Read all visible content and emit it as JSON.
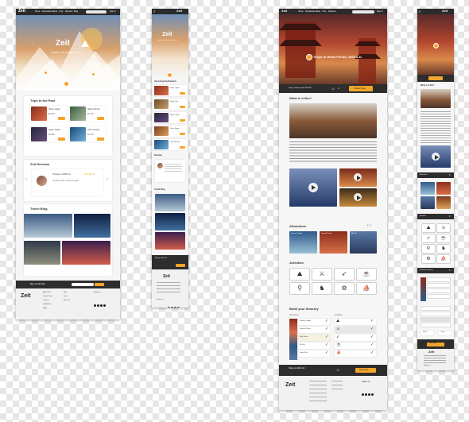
{
  "brand": {
    "name": "Zeit",
    "tagline": "Explore The Portals Of Time"
  },
  "nav": {
    "links": [
      "Home",
      "Destinations",
      "Eras",
      "Trips",
      "Reviews",
      "Blog",
      "Contact"
    ],
    "login": "Sign In"
  },
  "screen1": {
    "past_trips": {
      "title": "Trips to the Past",
      "cards": [
        {
          "name": "Tokyo, Japan",
          "price": "$2,450"
        },
        {
          "name": "Machu Picchu",
          "price": "$3,100"
        },
        {
          "name": "Kyoto, Japan",
          "price": "$1,980"
        },
        {
          "name": "Oslo, Norway",
          "price": "$2,750"
        }
      ],
      "book_label": "Book"
    },
    "reviews": {
      "title": "Zeit Reviews",
      "reviewer": "Traveler in 1950 B.C.",
      "stars": "★★★★★",
      "quote": "\"Amazing trip, would go again\""
    },
    "blog": {
      "title": "Travel Blog",
      "posts": [
        "Northern Lights",
        "Ancient Cities",
        "Mountain Trails",
        "Lost Coasts"
      ]
    },
    "newsletter": {
      "label": "Sign up with Zeit",
      "placeholder": "Email",
      "button": "Sign Up"
    },
    "footer": {
      "col1": [
        "About Zeit",
        "Travel Tours",
        "Careers",
        "Guidelines",
        "FAQs"
      ],
      "col2": [
        "Help",
        "Trips",
        "Account"
      ],
      "follow": "Follow us"
    }
  },
  "screen2": {
    "upcoming": {
      "title": "Upcoming Destinations",
      "items": [
        "Tokyo, Japan",
        "Rome, Italy",
        "Kyoto, Japan",
        "Cairo, Egypt",
        "Oslo, Norway"
      ]
    },
    "reviews_title": "Reviews",
    "blog_title": "Travel Blog",
    "newsletter": {
      "label": "Sign up with Zeit",
      "button": "Sign Up"
    },
    "follow": "Follow us"
  },
  "screen3": {
    "hero_title": "Tokyo in Heian Period, 1000 A.D.",
    "bar": {
      "destination": "Tokyo in Heian Period, 1000 A.D.",
      "travelers": "2",
      "book": "Book Now"
    },
    "what_title": "What is it like?",
    "body_text": "Lorem ipsum dolor sit amet, consectetur adipiscing elit, sed diam nonummy nibh euismod tincidunt ut laoreet dolore magna aliquam erat volutpat.",
    "attractions": {
      "title": "Attractions",
      "items": [
        "Senso-ji Temple",
        "Imperial Palace",
        "Mt. Fuji"
      ]
    },
    "activities": {
      "title": "Activities",
      "icons": [
        "hiking-icon",
        "sword-icon",
        "archery-icon",
        "tea-icon",
        "cycling-icon",
        "horse-icon",
        "rickshaw-icon",
        "boat-icon"
      ]
    },
    "itinerary": {
      "title": "Build your itinerary",
      "col1": "Attractions",
      "col2": "Activities",
      "rows": [
        "Senso-ji Temple",
        "Imperial Palace",
        "Meiji Shrine",
        "Mt. Fuji",
        "Ueno Park"
      ]
    },
    "bottom_bar": {
      "label": "Tokyo in 1000 A.D.",
      "book": "Book Now"
    },
    "follow": "Follow us"
  },
  "screen4": {
    "what_title": "What is it like?",
    "attractions_title": "Attractions",
    "activities_title": "Activities",
    "itinerary_title": "Build your itinerary",
    "reset": "Reset",
    "save": "Save",
    "book": "Book Now",
    "follow": "Follow us"
  },
  "colors": {
    "accent": "#f2a52b",
    "dark": "#2d2d2d"
  }
}
